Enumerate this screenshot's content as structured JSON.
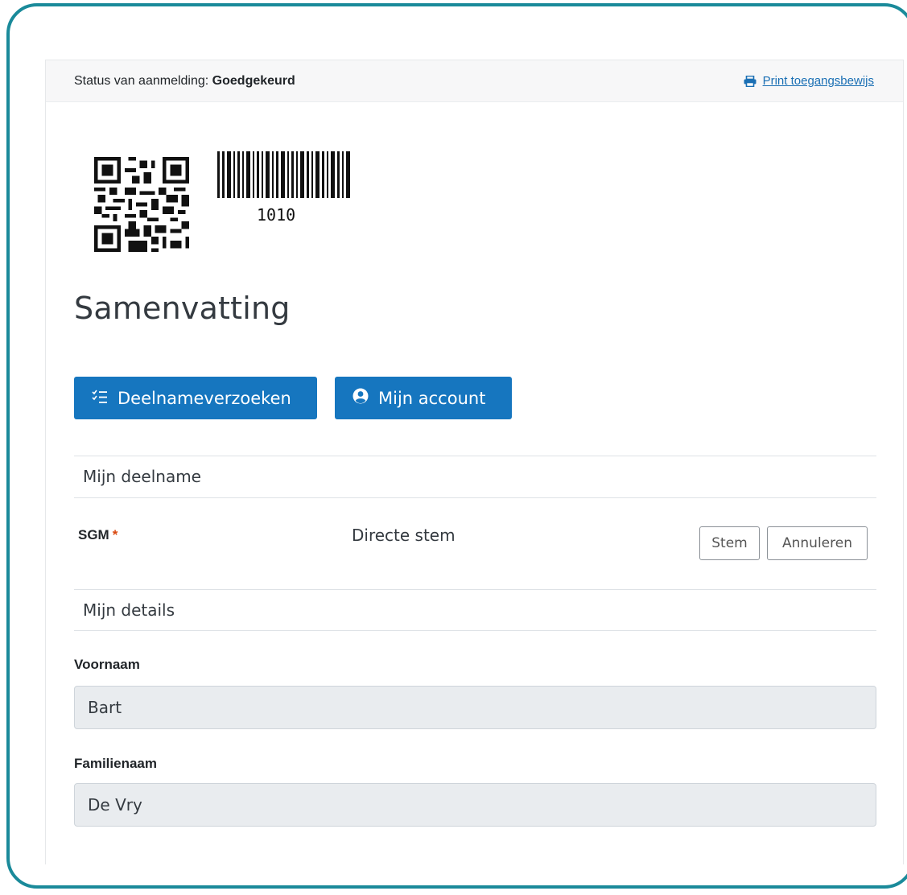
{
  "header": {
    "status_prefix": "Status van aanmelding: ",
    "status_value": "Goedgekeurd",
    "print_label": "Print toegangsbewijs"
  },
  "barcode": {
    "number": "1010"
  },
  "summary": {
    "title": "Samenvatting"
  },
  "actions": {
    "requests_label": "Deelnameverzoeken",
    "account_label": "Mijn account"
  },
  "participation": {
    "section_label": "Mijn deelname",
    "item_label": "SGM",
    "required_marker": "*",
    "vote_type": "Directe stem",
    "stem_label": "Stem",
    "cancel_label": "Annuleren"
  },
  "details": {
    "section_label": "Mijn details",
    "first_name_label": "Voornaam",
    "first_name_value": "Bart",
    "last_name_label": "Familienaam",
    "last_name_value": "De Vry"
  },
  "colors": {
    "frame": "#1a8a9a",
    "primary": "#1676bf",
    "link": "#1a6fb4",
    "required": "#d9480f"
  },
  "icons": {
    "print": "printer-icon",
    "requests": "checklist-icon",
    "account": "user-circle-icon"
  }
}
